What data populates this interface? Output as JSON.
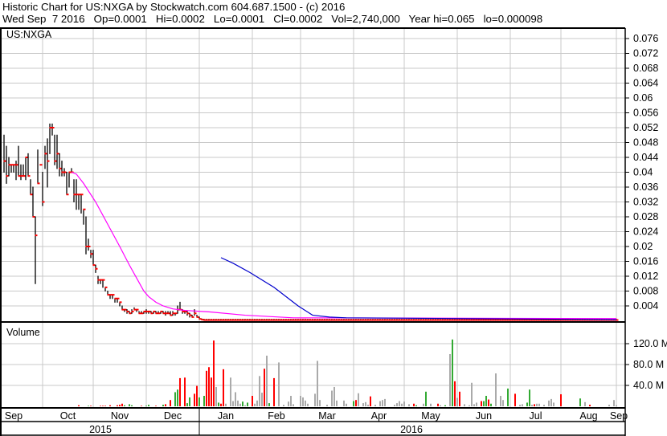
{
  "header": {
    "title_line": "Historic Chart for US:NXGA by Stockwatch.com 604.687.1500 - (c) 2016",
    "quote_line": "Wed Sep  7 2016   Op=0.0001   Hi=0.0002   Lo=0.0001   Cl=0.0002   Vol=2,740,000   Year hi=0.065   lo=0.000098"
  },
  "colors": {
    "bar": "#000000",
    "close_tick": "#ff0000",
    "ma_short": "#ff00ff",
    "ma_long": "#0000cc",
    "vol_up": "#33aa33",
    "vol_down": "#ff0000",
    "vol_flat": "#aaaaaa",
    "grid": "#c8c8c8"
  },
  "chart_data": {
    "type": "bar",
    "title": "US:NXGA",
    "price_panel": {
      "values_in_thousandths": true,
      "yticks": [
        "0.004",
        "0.008",
        "0.012",
        "0.016",
        "0.02",
        "0.024",
        "0.028",
        "0.032",
        "0.036",
        "0.04",
        "0.044",
        "0.048",
        "0.052",
        "0.056",
        "0.06",
        "0.064",
        "0.068",
        "0.072",
        "0.076"
      ],
      "ylim": [
        0,
        0.078
      ],
      "bars_day_high_low_close": [
        [
          0,
          50,
          40,
          43
        ],
        [
          1,
          47,
          37,
          39
        ],
        [
          2,
          44,
          39,
          42
        ],
        [
          3,
          42,
          40,
          42
        ],
        [
          4,
          42,
          40,
          42
        ],
        [
          5,
          43,
          38,
          42
        ],
        [
          6,
          47,
          39,
          39
        ],
        [
          7,
          42,
          38,
          39
        ],
        [
          8,
          42,
          39,
          39
        ],
        [
          9,
          44,
          38,
          44
        ],
        [
          10,
          45,
          39,
          39
        ],
        [
          11,
          38,
          34,
          34
        ],
        [
          12,
          36,
          28,
          28
        ],
        [
          13,
          28,
          10,
          23
        ],
        [
          14,
          46,
          37,
          37
        ],
        [
          15,
          42,
          42,
          42
        ],
        [
          16,
          40,
          31,
          32
        ],
        [
          17,
          47,
          41,
          45
        ],
        [
          18,
          49,
          36,
          43
        ],
        [
          19,
          53,
          45,
          52
        ],
        [
          20,
          53,
          50,
          52
        ],
        [
          21,
          50,
          42,
          43
        ],
        [
          22,
          50,
          41,
          45
        ],
        [
          23,
          45,
          39,
          41
        ],
        [
          24,
          43,
          39,
          40
        ],
        [
          25,
          41,
          39,
          40
        ],
        [
          26,
          40,
          34,
          34
        ],
        [
          27,
          40,
          36,
          40
        ],
        [
          28,
          41,
          40,
          40
        ],
        [
          29,
          38,
          32,
          34
        ],
        [
          30,
          38,
          30,
          34
        ],
        [
          31,
          34,
          30,
          34
        ],
        [
          32,
          34,
          29,
          34
        ],
        [
          33,
          30,
          26,
          30
        ],
        [
          34,
          28,
          18,
          20
        ],
        [
          35,
          22,
          19,
          20
        ],
        [
          36,
          19,
          17,
          18
        ],
        [
          37,
          19,
          15,
          15
        ],
        [
          38,
          15,
          13,
          14
        ],
        [
          39,
          12,
          10,
          11
        ],
        [
          40,
          11,
          10,
          11
        ],
        [
          41,
          11,
          9,
          11
        ],
        [
          42,
          9,
          8,
          9
        ],
        [
          43,
          8,
          7,
          7
        ],
        [
          44,
          7,
          6,
          7
        ],
        [
          45,
          7,
          6,
          7
        ],
        [
          46,
          6,
          5,
          6
        ],
        [
          47,
          6,
          5,
          6
        ],
        [
          48,
          5,
          4,
          5
        ],
        [
          49,
          4,
          3,
          3
        ],
        [
          50,
          3,
          2.5,
          3
        ],
        [
          51,
          3,
          2,
          2.5
        ],
        [
          52,
          2.5,
          2,
          2
        ],
        [
          53,
          3,
          2,
          2.5
        ],
        [
          54,
          3.5,
          3,
          3
        ],
        [
          55,
          3,
          2.5,
          3
        ],
        [
          56,
          2.5,
          2,
          2
        ],
        [
          57,
          2.5,
          2,
          2
        ],
        [
          58,
          2.5,
          2,
          2.5
        ],
        [
          59,
          3,
          2,
          2.5
        ],
        [
          60,
          2.5,
          2,
          2.5
        ],
        [
          61,
          2.5,
          2,
          2
        ],
        [
          62,
          2.5,
          2,
          2.5
        ],
        [
          63,
          2.5,
          2,
          2
        ],
        [
          64,
          2.5,
          2,
          2
        ],
        [
          65,
          2.5,
          2,
          2.5
        ],
        [
          66,
          2.5,
          2,
          2
        ],
        [
          67,
          2.5,
          1.5,
          2
        ],
        [
          68,
          2.5,
          2,
          2
        ],
        [
          69,
          2.5,
          1.5,
          1.5
        ],
        [
          70,
          2.5,
          1.5,
          2
        ],
        [
          71,
          2,
          1.5,
          2
        ],
        [
          72,
          4,
          2,
          3
        ],
        [
          73,
          5,
          3,
          3
        ],
        [
          74,
          3,
          2,
          2.5
        ],
        [
          75,
          2.5,
          2,
          2.5
        ],
        [
          76,
          2.5,
          1.5,
          2
        ],
        [
          77,
          2,
          1,
          1.5
        ],
        [
          78,
          1.5,
          1,
          1
        ],
        [
          79,
          3,
          1.5,
          2
        ],
        [
          80,
          1.5,
          1,
          1
        ],
        [
          81,
          1,
          0.5,
          0.5
        ],
        [
          82,
          0.5,
          0.3,
          0.3
        ]
      ],
      "tail": {
        "from_day": 83,
        "to_day": 254,
        "high": 0.4,
        "low": 0.1,
        "close": 0.2
      },
      "ma_short": [
        [
          28,
          40
        ],
        [
          30,
          39.5
        ],
        [
          33,
          37
        ],
        [
          38,
          32
        ],
        [
          43,
          26
        ],
        [
          48,
          20
        ],
        [
          52,
          15
        ],
        [
          55,
          11.5
        ],
        [
          58,
          8
        ],
        [
          60,
          6.5
        ],
        [
          63,
          5
        ],
        [
          66,
          4
        ],
        [
          70,
          3.2
        ],
        [
          75,
          2.8
        ],
        [
          85,
          2.4
        ],
        [
          100,
          1.5
        ],
        [
          120,
          0.8
        ],
        [
          254,
          0.6
        ]
      ],
      "ma_long": [
        [
          90,
          17
        ],
        [
          95,
          15.5
        ],
        [
          102,
          13
        ],
        [
          112,
          9
        ],
        [
          118,
          6
        ],
        [
          122,
          4
        ],
        [
          128,
          1.5
        ],
        [
          135,
          1
        ],
        [
          142,
          0.8
        ],
        [
          254,
          0.3
        ]
      ]
    },
    "volume_panel": {
      "label": "Volume",
      "unit": "M",
      "yticks": [
        "40.0 M",
        "80.0 M",
        "120.0 M"
      ],
      "ytick_values": [
        40,
        80,
        120
      ],
      "bars_day_volume_dir": [
        [
          31,
          2,
          "r"
        ],
        [
          35,
          1,
          "g"
        ],
        [
          36,
          1,
          "r"
        ],
        [
          40,
          1,
          "r"
        ],
        [
          41,
          1,
          "r"
        ],
        [
          42,
          1,
          "r"
        ],
        [
          44,
          2,
          "r"
        ],
        [
          47,
          2,
          "r"
        ],
        [
          48,
          3,
          "r"
        ],
        [
          49,
          5,
          "r"
        ],
        [
          50,
          2,
          "g"
        ],
        [
          52,
          4,
          "g"
        ],
        [
          53,
          2,
          "g"
        ],
        [
          57,
          1,
          "r"
        ],
        [
          59,
          1,
          "g"
        ],
        [
          60,
          3,
          "g"
        ],
        [
          63,
          1,
          "r"
        ],
        [
          66,
          3,
          "g"
        ],
        [
          67,
          4,
          "r"
        ],
        [
          69,
          12,
          "r"
        ],
        [
          71,
          27,
          "g"
        ],
        [
          72,
          32,
          "g"
        ],
        [
          73,
          54,
          "r"
        ],
        [
          75,
          55,
          "r"
        ],
        [
          76,
          6,
          "g"
        ],
        [
          77,
          17,
          "g"
        ],
        [
          79,
          24,
          "r"
        ],
        [
          80,
          39,
          "r"
        ],
        [
          81,
          17,
          "g"
        ],
        [
          83,
          20,
          "g"
        ],
        [
          84,
          68,
          "r"
        ],
        [
          85,
          75,
          "r"
        ],
        [
          86,
          55,
          "r"
        ],
        [
          87,
          126,
          "r"
        ],
        [
          88,
          37,
          "n"
        ],
        [
          89,
          7,
          "g"
        ],
        [
          90,
          5,
          "r"
        ],
        [
          91,
          71,
          "r"
        ],
        [
          92,
          5,
          "n"
        ],
        [
          94,
          55,
          "n"
        ],
        [
          95,
          10,
          "n"
        ],
        [
          96,
          27,
          "n"
        ],
        [
          97,
          11,
          "n"
        ],
        [
          98,
          5,
          "n"
        ],
        [
          99,
          9,
          "g"
        ],
        [
          100,
          2,
          "n"
        ],
        [
          101,
          7,
          "g"
        ],
        [
          103,
          20,
          "r"
        ],
        [
          104,
          5,
          "n"
        ],
        [
          105,
          11,
          "n"
        ],
        [
          106,
          58,
          "n"
        ],
        [
          107,
          26,
          "n"
        ],
        [
          108,
          72,
          "r"
        ],
        [
          109,
          97,
          "n"
        ],
        [
          110,
          6,
          "g"
        ],
        [
          112,
          54,
          "r"
        ],
        [
          114,
          84,
          "n"
        ],
        [
          116,
          3,
          "n"
        ],
        [
          118,
          9,
          "n"
        ],
        [
          119,
          20,
          "n"
        ],
        [
          120,
          4,
          "n"
        ],
        [
          123,
          20,
          "n"
        ],
        [
          124,
          17,
          "n"
        ],
        [
          125,
          11,
          "n"
        ],
        [
          126,
          5,
          "n"
        ],
        [
          129,
          24,
          "n"
        ],
        [
          130,
          87,
          "n"
        ],
        [
          131,
          12,
          "n"
        ],
        [
          134,
          3,
          "n"
        ],
        [
          136,
          30,
          "n"
        ],
        [
          137,
          37,
          "n"
        ],
        [
          138,
          11,
          "n"
        ],
        [
          141,
          11,
          "n"
        ],
        [
          142,
          5,
          "n"
        ],
        [
          145,
          10,
          "g"
        ],
        [
          146,
          12,
          "r"
        ],
        [
          147,
          25,
          "n"
        ],
        [
          149,
          6,
          "n"
        ],
        [
          150,
          8,
          "n"
        ],
        [
          151,
          3,
          "n"
        ],
        [
          152,
          19,
          "r"
        ],
        [
          154,
          3,
          "n"
        ],
        [
          156,
          10,
          "n"
        ],
        [
          157,
          12,
          "n"
        ],
        [
          158,
          14,
          "n"
        ],
        [
          162,
          3,
          "n"
        ],
        [
          163,
          6,
          "n"
        ],
        [
          164,
          10,
          "n"
        ],
        [
          165,
          5,
          "n"
        ],
        [
          166,
          9,
          "n"
        ],
        [
          168,
          4,
          "n"
        ],
        [
          170,
          5,
          "r"
        ],
        [
          171,
          2,
          "g"
        ],
        [
          174,
          5,
          "n"
        ],
        [
          175,
          28,
          "g"
        ],
        [
          177,
          5,
          "n"
        ],
        [
          180,
          5,
          "r"
        ],
        [
          181,
          2,
          "n"
        ],
        [
          183,
          2,
          "g"
        ],
        [
          185,
          100,
          "n"
        ],
        [
          186,
          128,
          "g"
        ],
        [
          187,
          48,
          "r"
        ],
        [
          188,
          16,
          "n"
        ],
        [
          189,
          28,
          "r"
        ],
        [
          191,
          4,
          "n"
        ],
        [
          193,
          2,
          "n"
        ],
        [
          194,
          45,
          "n"
        ],
        [
          195,
          4,
          "n"
        ],
        [
          196,
          7,
          "n"
        ],
        [
          198,
          10,
          "r"
        ],
        [
          199,
          10,
          "g"
        ],
        [
          200,
          20,
          "g"
        ],
        [
          201,
          13,
          "r"
        ],
        [
          202,
          5,
          "g"
        ],
        [
          204,
          63,
          "n"
        ],
        [
          206,
          20,
          "n"
        ],
        [
          207,
          12,
          "n"
        ],
        [
          209,
          34,
          "g"
        ],
        [
          212,
          24,
          "r"
        ],
        [
          214,
          3,
          "n"
        ],
        [
          215,
          4,
          "n"
        ],
        [
          217,
          7,
          "g"
        ],
        [
          218,
          32,
          "g"
        ],
        [
          219,
          3,
          "n"
        ],
        [
          220,
          4,
          "r"
        ],
        [
          221,
          5,
          "n"
        ],
        [
          222,
          5,
          "n"
        ],
        [
          224,
          3,
          "n"
        ],
        [
          226,
          11,
          "n"
        ],
        [
          227,
          14,
          "n"
        ],
        [
          228,
          7,
          "n"
        ],
        [
          231,
          23,
          "r"
        ],
        [
          239,
          15,
          "g"
        ],
        [
          241,
          8,
          "n"
        ],
        [
          243,
          3,
          "r"
        ],
        [
          251,
          3,
          "n"
        ],
        [
          253,
          12,
          "n"
        ],
        [
          254,
          2,
          "n"
        ]
      ]
    },
    "months": [
      {
        "label": "Sep",
        "start": -8
      },
      {
        "label": "Oct",
        "start": 16
      },
      {
        "label": "Nov",
        "start": 37
      },
      {
        "label": "Dec",
        "start": 59
      },
      {
        "label": "Jan",
        "start": 81
      },
      {
        "label": "Feb",
        "start": 103
      },
      {
        "label": "Mar",
        "start": 123
      },
      {
        "label": "Apr",
        "start": 145
      },
      {
        "label": "May",
        "start": 166
      },
      {
        "label": "Jun",
        "start": 188
      },
      {
        "label": "Jul",
        "start": 210
      },
      {
        "label": "Aug",
        "start": 231
      },
      {
        "label": "Sep",
        "start": 254
      }
    ],
    "years": [
      {
        "label": "2015",
        "start": -1,
        "end": 81
      },
      {
        "label": "2016",
        "start": 81,
        "end": 257
      }
    ],
    "grid": true
  }
}
